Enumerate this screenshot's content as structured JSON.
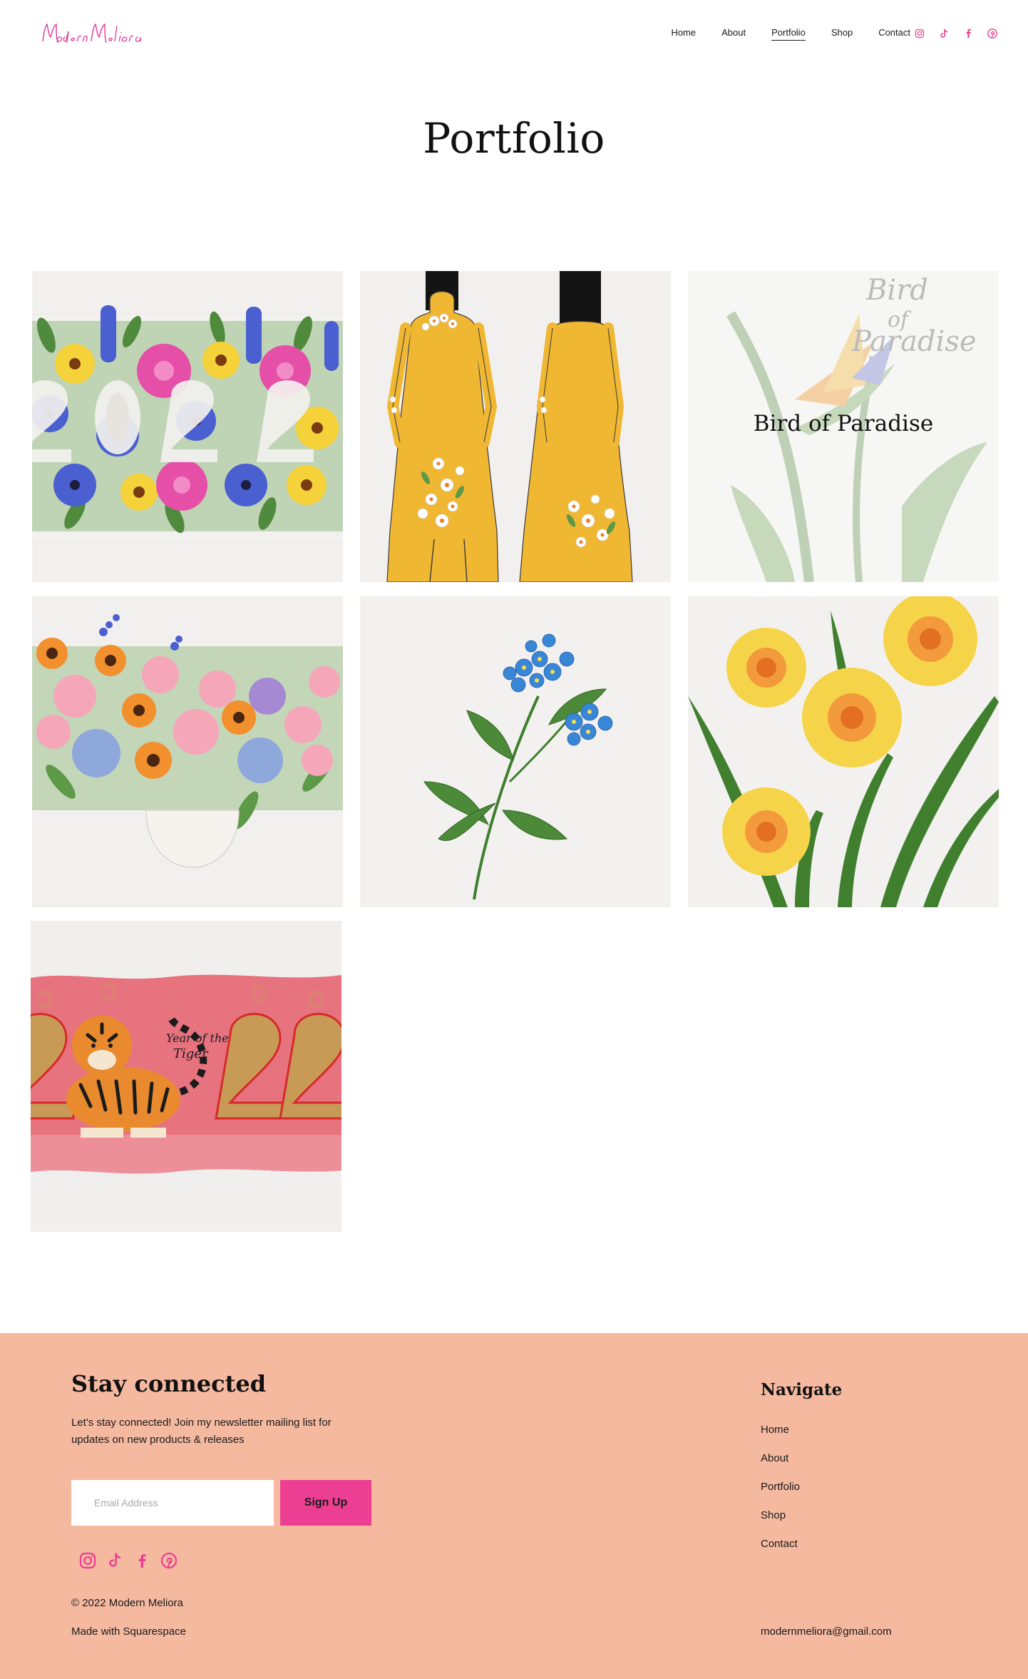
{
  "header": {
    "logo_text": "Modern Meliora",
    "nav": [
      {
        "label": "Home",
        "active": false
      },
      {
        "label": "About",
        "active": false
      },
      {
        "label": "Portfolio",
        "active": true
      },
      {
        "label": "Shop",
        "active": false
      },
      {
        "label": "Contact",
        "active": false
      }
    ],
    "social_icons": [
      "instagram-icon",
      "tiktok-icon",
      "facebook-icon",
      "pinterest-icon"
    ]
  },
  "page": {
    "title": "Portfolio"
  },
  "gallery": {
    "items": [
      {
        "artwork": "2022 floral lettering"
      },
      {
        "artwork": "yellow ao dai dress with daisies"
      },
      {
        "artwork": "bird of paradise",
        "label": "Bird of Paradise",
        "image_lettering": "Bird of Paradise"
      },
      {
        "artwork": "flower bouquet in white vase"
      },
      {
        "artwork": "blue forget-me-not sprig"
      },
      {
        "artwork": "yellow daffodils"
      },
      {
        "artwork": "Year of the Tiger 2022",
        "image_lettering": "Year of the Tiger"
      }
    ]
  },
  "footer": {
    "heading": "Stay connected",
    "text": "Let's stay connected! Join my newsletter mailing list for updates on new products & releases",
    "email_placeholder": "Email Address",
    "signup_label": "Sign Up",
    "copyright": "© 2022 Modern Meliora",
    "made_with": "Made with Squarespace",
    "nav_title": "Navigate",
    "nav": [
      "Home",
      "About",
      "Portfolio",
      "Shop",
      "Contact"
    ],
    "email": "modernmeliora@gmail.com"
  },
  "colors": {
    "accent_pink": "#ec3f93",
    "footer_bg": "#f5b9a0",
    "text": "#1a1a1a"
  }
}
